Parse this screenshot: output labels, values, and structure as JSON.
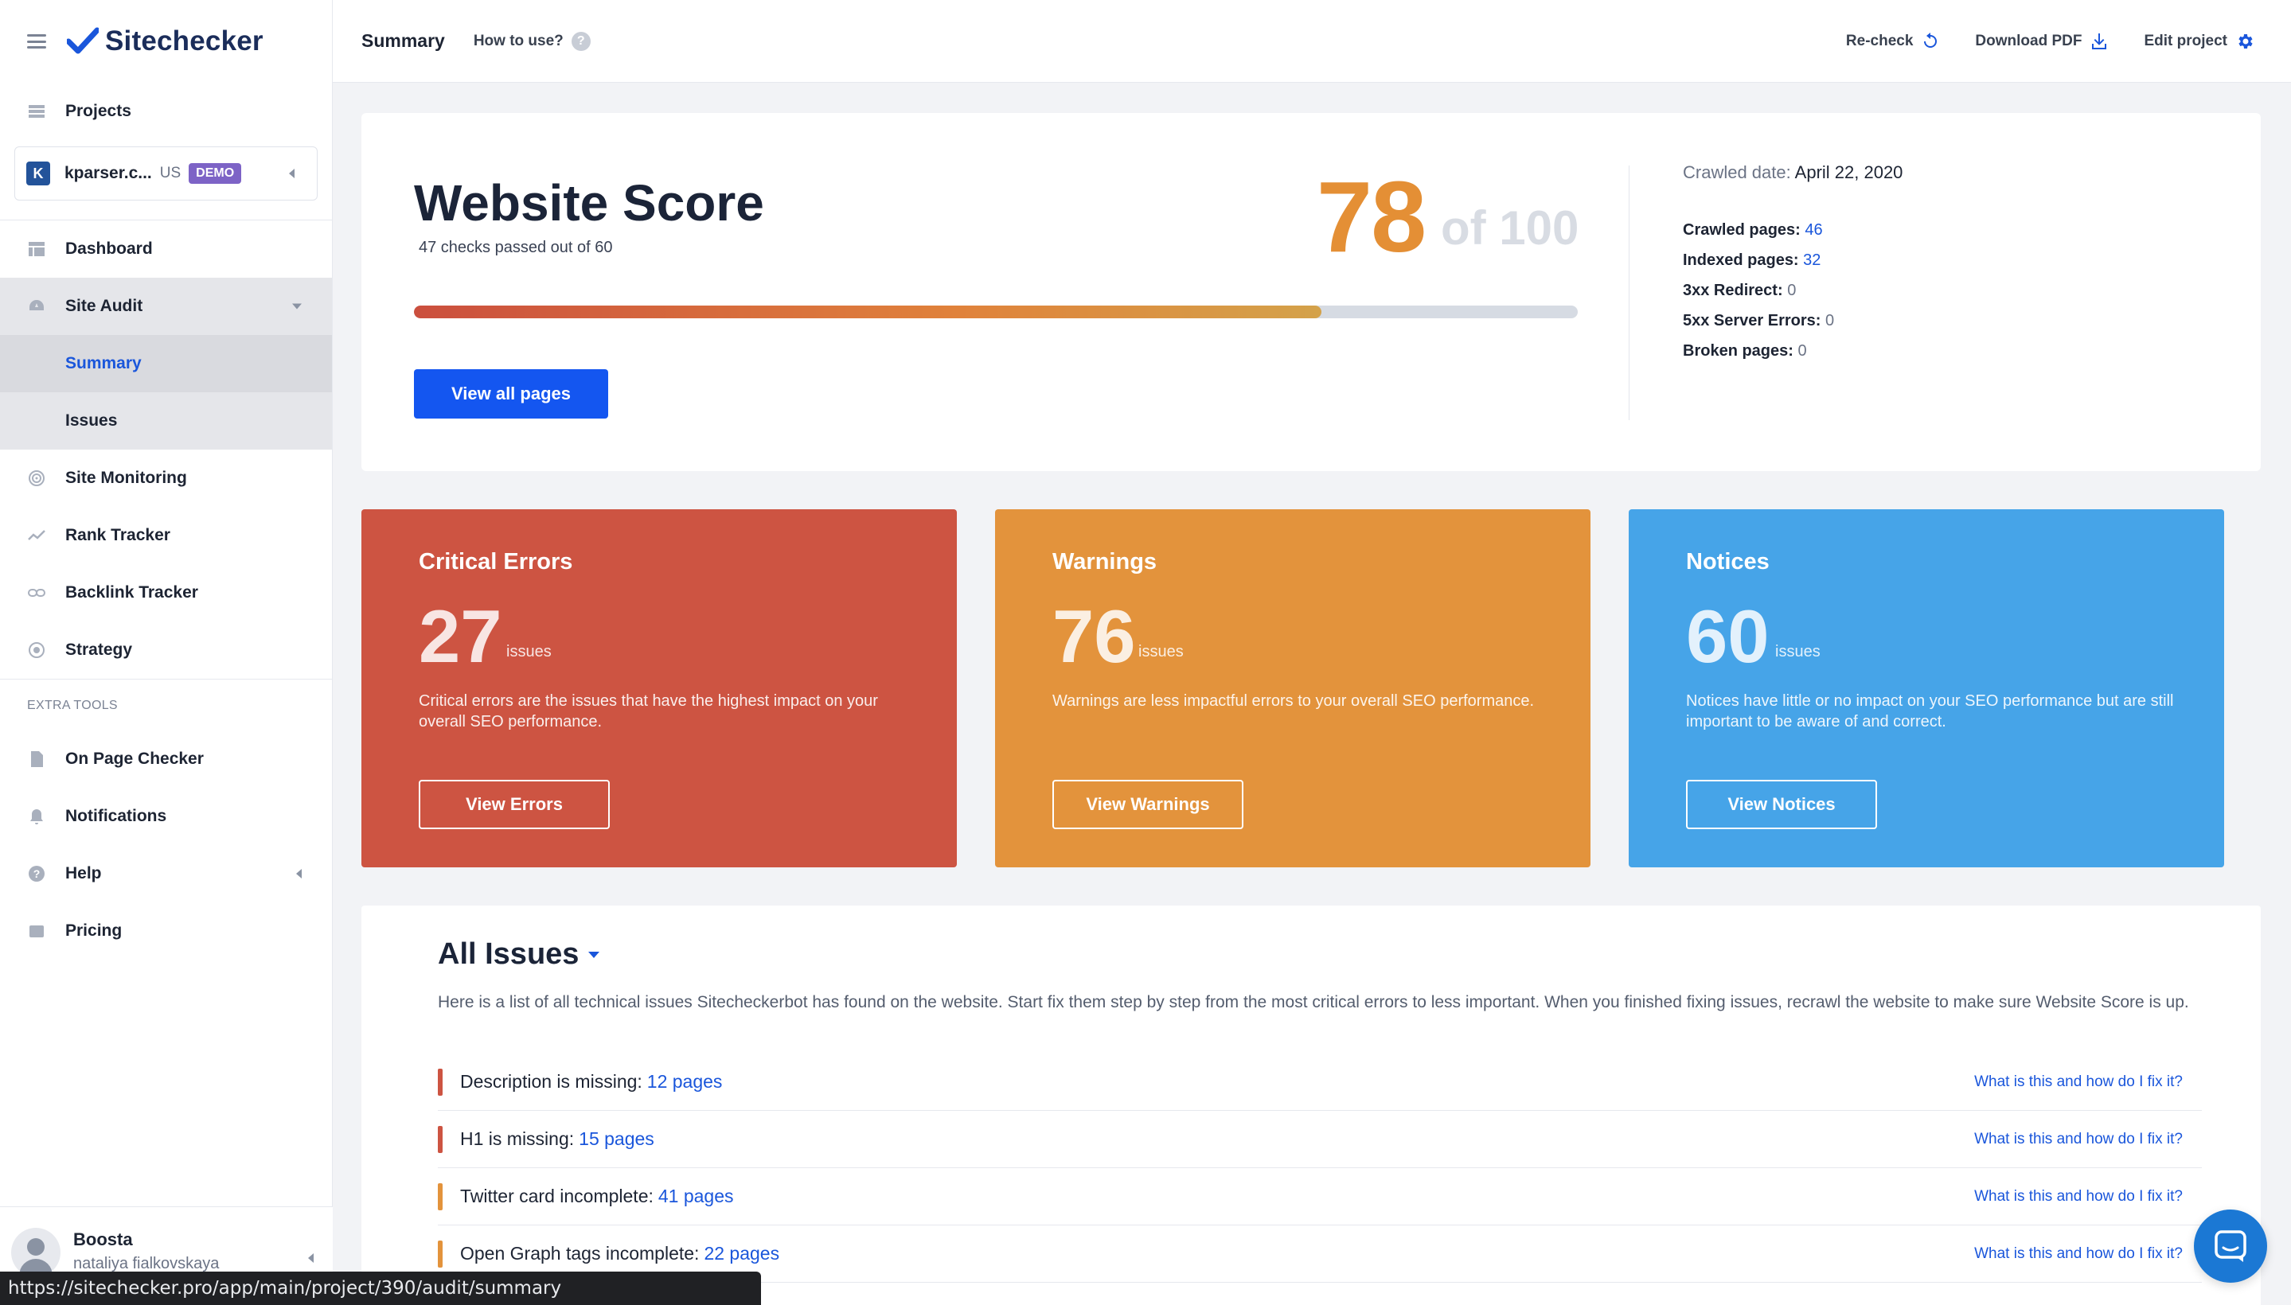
{
  "sidebar": {
    "brand": "Sitechecker",
    "projects_label": "Projects",
    "project": {
      "initial": "K",
      "name": "kparser.c...",
      "country": "US",
      "badge": "DEMO"
    },
    "items": [
      {
        "label": "Dashboard"
      },
      {
        "label": "Site Audit"
      },
      {
        "label": "Site Monitoring"
      },
      {
        "label": "Rank Tracker"
      },
      {
        "label": "Backlink Tracker"
      },
      {
        "label": "Strategy"
      }
    ],
    "site_audit_sub": [
      {
        "label": "Summary"
      },
      {
        "label": "Issues"
      }
    ],
    "extra_tools_title": "EXTRA TOOLS",
    "extra_items": [
      {
        "label": "On Page Checker"
      },
      {
        "label": "Notifications"
      },
      {
        "label": "Help"
      },
      {
        "label": "Pricing"
      }
    ],
    "user": {
      "name": "Boosta",
      "sub": "nataliya fialkovskaya"
    }
  },
  "topbar": {
    "title": "Summary",
    "how_to": "How to use?",
    "recheck": "Re-check",
    "download_pdf": "Download PDF",
    "edit_project": "Edit project"
  },
  "score": {
    "title": "Website Score",
    "subtitle": "47 checks passed out of 60",
    "value": "78",
    "of": "of 100",
    "progress_fraction": 0.78,
    "button": "View all pages",
    "crawled_date_label": "Crawled date:",
    "crawled_date": "April 22, 2020",
    "stats": [
      {
        "label": "Crawled pages:",
        "value": "46",
        "link": true
      },
      {
        "label": "Indexed pages:",
        "value": "32",
        "link": true
      },
      {
        "label": "3xx Redirect:",
        "value": "0",
        "link": false
      },
      {
        "label": "5xx Server Errors:",
        "value": "0",
        "link": false
      },
      {
        "label": "Broken pages:",
        "value": "0",
        "link": false
      }
    ]
  },
  "cards": [
    {
      "title": "Critical Errors",
      "count": "27",
      "unit": "issues",
      "desc": "Critical errors are the issues that have the highest impact on your overall SEO performance.",
      "button": "View Errors",
      "color": "#cd5442"
    },
    {
      "title": "Warnings",
      "count": "76",
      "unit": "issues",
      "desc": "Warnings are less impactful errors to your overall SEO performance.",
      "button": "View Warnings",
      "color": "#e3933c"
    },
    {
      "title": "Notices",
      "count": "60",
      "unit": "issues",
      "desc": "Notices have little or no impact on your SEO performance but are still important to be aware of and correct.",
      "button": "View Notices",
      "color": "#46a4e8"
    }
  ],
  "all_issues": {
    "title": "All Issues",
    "description": "Here is a list of all technical issues Sitecheckerbot has found on the website. Start fix them step by step from the most critical errors to less important. When you finished fixing issues, recrawl the website to make sure Website Score is up.",
    "help_text": "What is this and how do I fix it?",
    "rows": [
      {
        "text": "Description is missing:",
        "pages": "12 pages",
        "severity": "red"
      },
      {
        "text": "H1 is missing:",
        "pages": "15 pages",
        "severity": "red"
      },
      {
        "text": "Twitter card incomplete:",
        "pages": "41 pages",
        "severity": "orange"
      },
      {
        "text": "Open Graph tags incomplete:",
        "pages": "22 pages",
        "severity": "orange"
      }
    ]
  },
  "status_url": "https://sitechecker.pro/app/main/project/390/audit/summary"
}
